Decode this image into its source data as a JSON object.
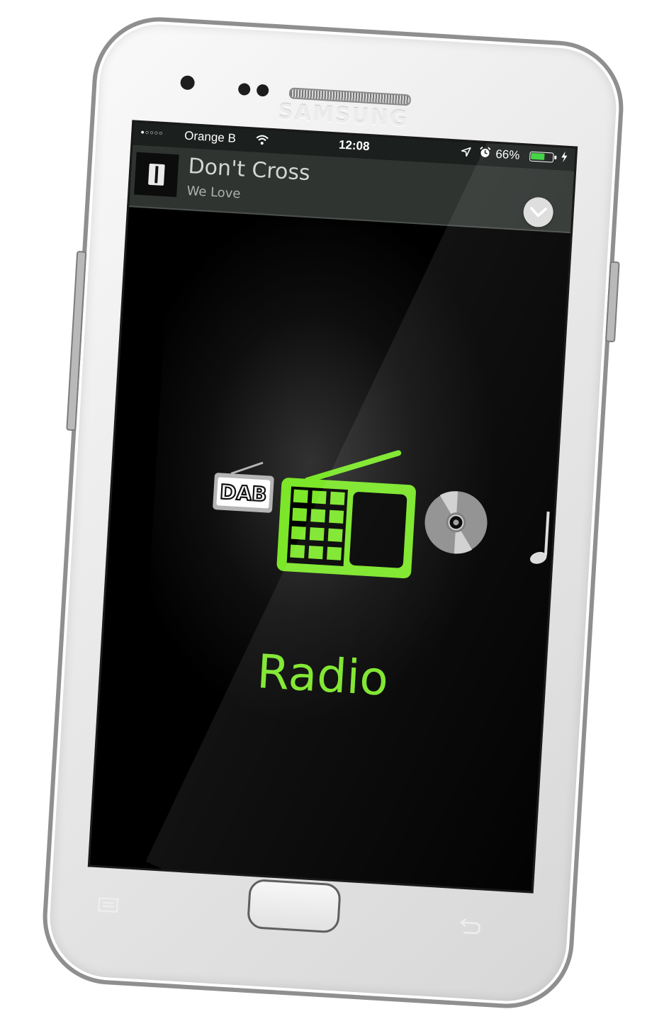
{
  "device": {
    "brand": "SAMSUNG"
  },
  "status_bar": {
    "signal_dots": "●○○○○",
    "carrier": "Orange B",
    "time": "12:08",
    "battery_percent": "66%",
    "battery_level": 0.66,
    "icons": [
      "wifi-icon",
      "location-icon",
      "alarm-icon",
      "battery-icon",
      "charging-icon"
    ]
  },
  "now_playing": {
    "title": "Don't Cross",
    "artist": "We Love",
    "collapse_icon": "chevron-down-icon"
  },
  "sources": {
    "items": [
      {
        "name": "DAB",
        "icon": "dab-radio-icon"
      },
      {
        "name": "Radio",
        "icon": "radio-icon"
      },
      {
        "name": "CD",
        "icon": "cd-icon"
      },
      {
        "name": "Music",
        "icon": "music-note-icon"
      }
    ],
    "selected_label": "Radio"
  },
  "colors": {
    "accent": "#7ce629",
    "status_bar_bg": "#1b1f1d",
    "now_playing_bg": "#2f3431",
    "screen_bg": "#000000",
    "inactive_icon": "#b5b5b5",
    "battery_fill": "#39d13a"
  },
  "hardware_keys": [
    "menu-key",
    "home-button",
    "back-key"
  ]
}
